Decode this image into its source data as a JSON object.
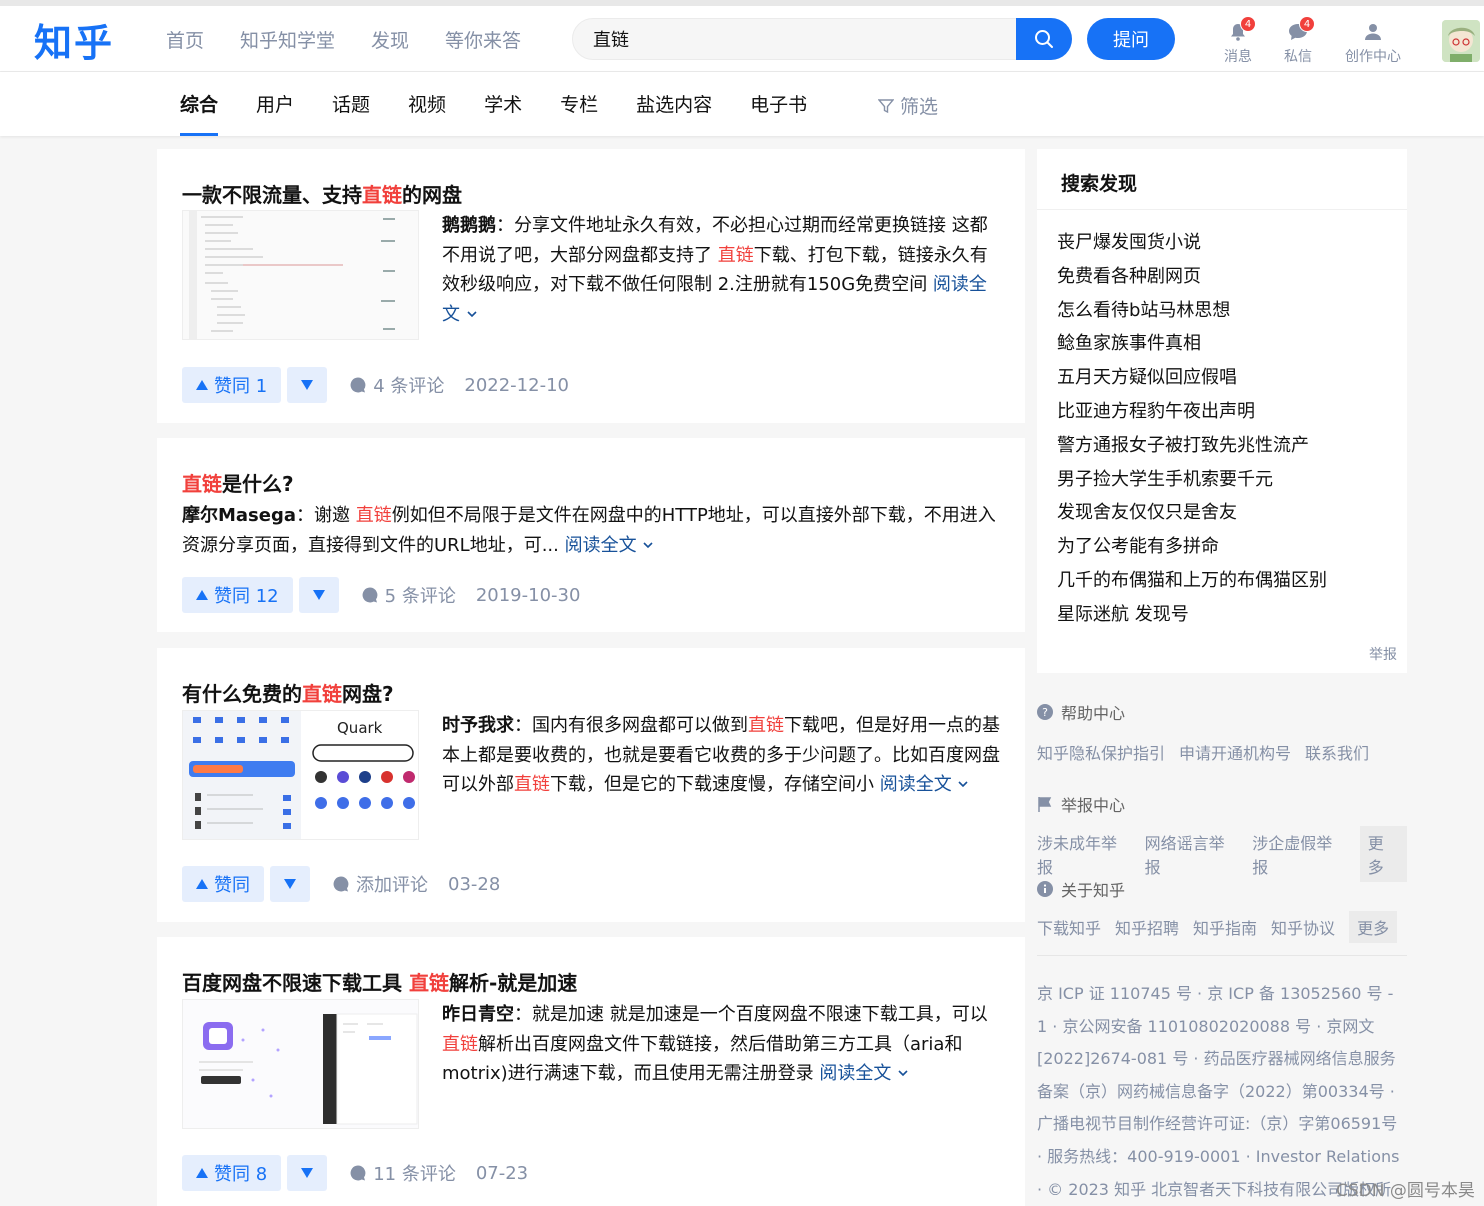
{
  "header": {
    "logo": "知乎",
    "nav": [
      "首页",
      "知乎知学堂",
      "发现",
      "等你来答"
    ],
    "search_value": "直链",
    "ask_label": "提问",
    "tools": [
      {
        "label": "消息",
        "badge": "4",
        "icon": "bell-icon"
      },
      {
        "label": "私信",
        "badge": "4",
        "icon": "chat-icon"
      },
      {
        "label": "创作中心",
        "badge": "",
        "icon": "creator-icon"
      }
    ]
  },
  "tabs": [
    "综合",
    "用户",
    "话题",
    "视频",
    "学术",
    "专栏",
    "盐选内容",
    "电子书"
  ],
  "filter_label": "筛选",
  "results": [
    {
      "title_pre": "一款不限流量、支持",
      "title_hl": "直链",
      "title_post": "的网盘",
      "author": "鹅鹅鹅",
      "text_pre": "：分享文件地址永久有效，不必担心过期而经常更换链接 这都不用说了吧，大部分网盘都支持了 ",
      "text_hl": "直链",
      "text_post": "下载、打包下载，链接永久有效秒级响应，对下载不做任何限制 2.注册就有150G免费空间 ",
      "read_more": "阅读全文",
      "vote": "赞同 1",
      "comments": "4 条评论",
      "date": "2022-12-10"
    },
    {
      "title_pre": "",
      "title_hl": "直链",
      "title_post": "是什么?",
      "author": "摩尔Masega",
      "text_pre": "：谢邀 ",
      "text_hl": "直链",
      "text_post": "例如但不局限于是文件在网盘中的HTTP地址，可以直接外部下载，不用进入资源分享页面，直接得到文件的URL地址，可... ",
      "read_more": "阅读全文",
      "vote": "赞同 12",
      "comments": "5 条评论",
      "date": "2019-10-30"
    },
    {
      "title_pre": "有什么免费的",
      "title_hl": "直链",
      "title_post": "网盘?",
      "author": "时予我求",
      "text_pre": "：国内有很多网盘都可以做到",
      "text_hl": "直链",
      "text_mid": "下载吧，但是好用一点的基本上都是要收费的，也就是要看它收费的多于少问题了。比如百度网盘可以外部",
      "text_hl2": "直链",
      "text_post": "下载，但是它的下载速度慢，存储空间小 ",
      "read_more": "阅读全文",
      "vote": "赞同",
      "comments": "添加评论",
      "date": "03-28",
      "thumb_text": "Quark"
    },
    {
      "title_pre": "百度网盘不限速下载工具 ",
      "title_hl": "直链",
      "title_post": "解析-就是加速",
      "author": "昨日青空",
      "text_pre": "：就是加速 就是加速是一个百度网盘不限速下载工具，可以",
      "text_hl": "直链",
      "text_post": "解析出百度网盘文件下载链接，然后借助第三方工具（aria和motrix)进行满速下载，而且使用无需注册登录 ",
      "read_more": "阅读全文",
      "vote": "赞同 8",
      "comments": "11 条评论",
      "date": "07-23"
    }
  ],
  "sidebar": {
    "title": "搜索发现",
    "items": [
      "丧尸爆发囤货小说",
      "免费看各种剧网页",
      "怎么看待b站马林思想",
      "鲶鱼家族事件真相",
      "五月天方疑似回应假唱",
      "比亚迪方程豹午夜出声明",
      "警方通报女子被打致先兆性流产",
      "男子捡大学生手机索要千元",
      "发现舍友仅仅只是舍友",
      "为了公考能有多拼命",
      "几千的布偶猫和上万的布偶猫区别",
      "星际迷航 发现号"
    ],
    "report": "举报"
  },
  "footer": {
    "help": {
      "title": "帮助中心",
      "links": [
        "知乎隐私保护指引",
        "申请开通机构号",
        "联系我们"
      ]
    },
    "report": {
      "title": "举报中心",
      "links": [
        "涉未成年举报",
        "网络谣言举报",
        "涉企虚假举报"
      ],
      "more": "更多"
    },
    "about": {
      "title": "关于知乎",
      "links": [
        "下载知乎",
        "知乎招聘",
        "知乎指南",
        "知乎协议"
      ],
      "more": "更多"
    },
    "legal": "京 ICP 证 110745 号 · 京 ICP 备 13052560 号 - 1 · 京公网安备 11010802020088 号 · 京网文[2022]2674-081 号 · 药品医疗器械网络信息服务备案（京）网药械信息备字（2022）第00334号 · 广播电视节目制作经营许可证:（京）字第06591号 · 服务热线：400-919-0001 · Investor Relations · © 2023 知乎 北京智者天下科技有限公司版权所有",
    "watermark": "CSDN @圆号本昊"
  }
}
